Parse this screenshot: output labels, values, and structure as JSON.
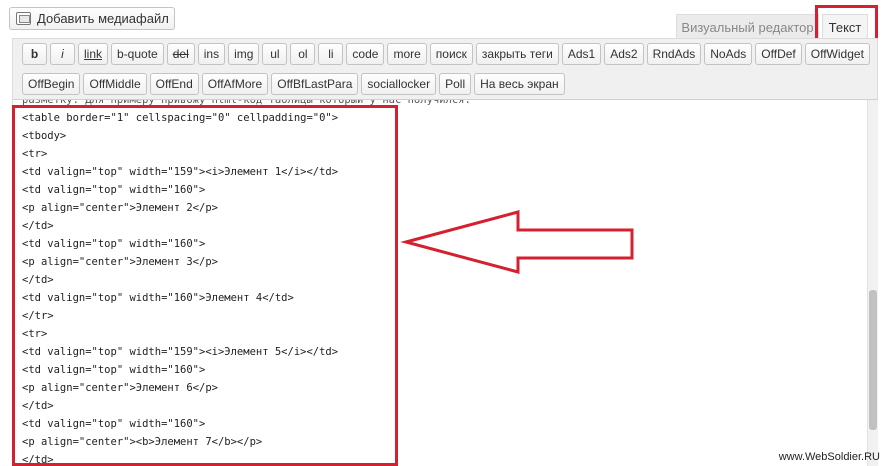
{
  "media_button": {
    "label": "Добавить медиафайл",
    "icon": "media-icon"
  },
  "tabs": {
    "visual": "Визуальный редактор",
    "text": "Текст",
    "active": "text"
  },
  "toolbar": {
    "row1": [
      {
        "id": "b",
        "label": "b"
      },
      {
        "id": "i",
        "label": "i"
      },
      {
        "id": "link",
        "label": "link"
      },
      {
        "id": "b-quote",
        "label": "b-quote"
      },
      {
        "id": "del",
        "label": "del"
      },
      {
        "id": "ins",
        "label": "ins"
      },
      {
        "id": "img",
        "label": "img"
      },
      {
        "id": "ul",
        "label": "ul"
      },
      {
        "id": "ol",
        "label": "ol"
      },
      {
        "id": "li",
        "label": "li"
      },
      {
        "id": "code",
        "label": "code"
      },
      {
        "id": "more",
        "label": "more"
      },
      {
        "id": "search",
        "label": "поиск"
      },
      {
        "id": "close-tags",
        "label": "закрыть теги"
      },
      {
        "id": "ads1",
        "label": "Ads1"
      },
      {
        "id": "ads2",
        "label": "Ads2"
      },
      {
        "id": "rndads",
        "label": "RndAds"
      },
      {
        "id": "noads",
        "label": "NoAds"
      },
      {
        "id": "offdef",
        "label": "OffDef"
      },
      {
        "id": "offwidget",
        "label": "OffWidget"
      }
    ],
    "row2": [
      {
        "id": "offbegin",
        "label": "OffBegin"
      },
      {
        "id": "offmiddle",
        "label": "OffMiddle"
      },
      {
        "id": "offend",
        "label": "OffEnd"
      },
      {
        "id": "offafmore",
        "label": "OffAfMore"
      },
      {
        "id": "offbflastpara",
        "label": "OffBfLastPara"
      },
      {
        "id": "sociallocker",
        "label": "sociallocker"
      },
      {
        "id": "poll",
        "label": "Poll"
      },
      {
        "id": "fullscreen",
        "label": "На весь экран"
      }
    ]
  },
  "editor": {
    "lines": [
      "разметку. Для примеру привожу html-код таблицы который у нас получился:",
      "<table border=\"1\" cellspacing=\"0\" cellpadding=\"0\">",
      "<tbody>",
      "<tr>",
      "<td valign=\"top\" width=\"159\"><i>Элемент 1</i></td>",
      "<td valign=\"top\" width=\"160\">",
      "<p align=\"center\">Элемент 2</p>",
      "</td>",
      "<td valign=\"top\" width=\"160\">",
      "<p align=\"center\">Элемент 3</p>",
      "</td>",
      "<td valign=\"top\" width=\"160\">Элемент 4</td>",
      "</tr>",
      "<tr>",
      "<td valign=\"top\" width=\"159\"><i>Элемент 5</i></td>",
      "<td valign=\"top\" width=\"160\">",
      "<p align=\"center\">Элемент 6</p>",
      "</td>",
      "<td valign=\"top\" width=\"160\">",
      "<p align=\"center\"><b>Элемент 7</b></p>",
      "</td>"
    ]
  },
  "annotation": {
    "highlight_color": "#d4202f",
    "arrow_icon": "left-arrow-icon"
  },
  "watermark": "www.WebSoldier.RU"
}
